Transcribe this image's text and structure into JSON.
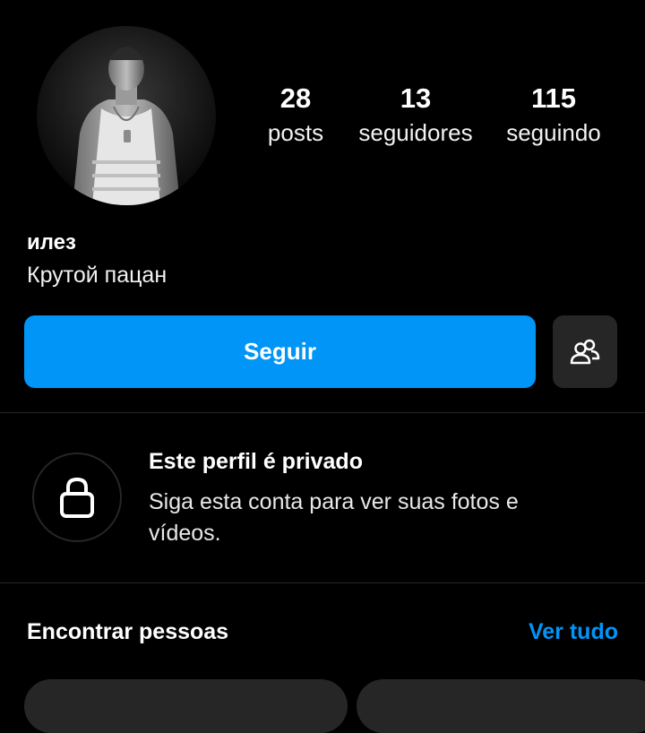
{
  "profile": {
    "username": "илез",
    "bio": "Крутой пацан",
    "stats": {
      "posts_count": "28",
      "posts_label": "posts",
      "followers_count": "13",
      "followers_label": "seguidores",
      "following_count": "115",
      "following_label": "seguindo"
    }
  },
  "actions": {
    "follow_label": "Seguir",
    "suggest_icon": "add-people-icon"
  },
  "private_notice": {
    "icon": "lock-icon",
    "title": "Este perfil é privado",
    "subtitle": "Siga esta conta para ver suas fotos e vídeos."
  },
  "suggestions": {
    "title": "Encontrar pessoas",
    "see_all_label": "Ver tudo"
  },
  "colors": {
    "background": "#000000",
    "accent": "#0095f6",
    "secondary_button": "#262626",
    "divider": "#262626"
  }
}
